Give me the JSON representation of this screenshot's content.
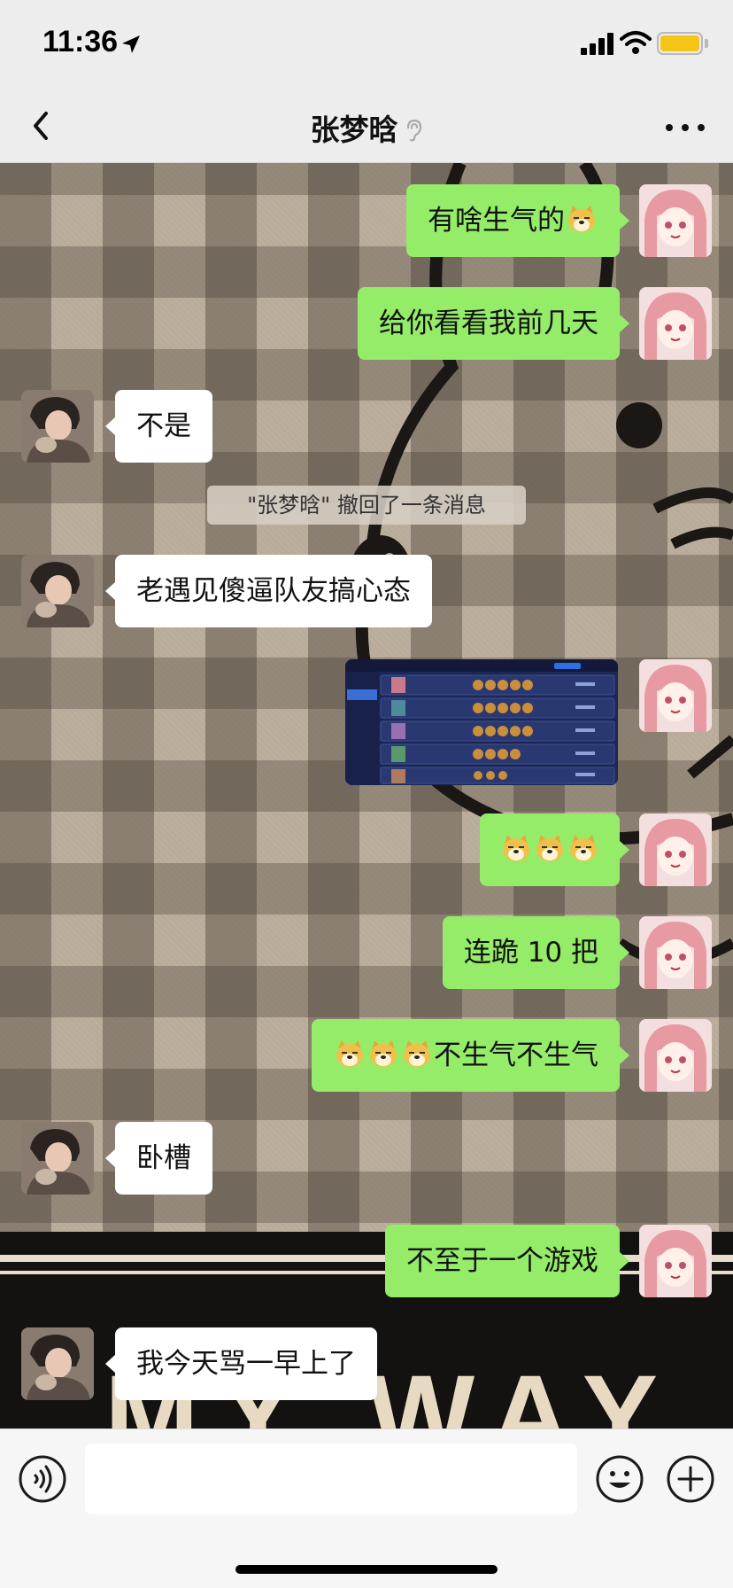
{
  "status_bar": {
    "time": "11:36",
    "signal_icon": "cellular-signal-icon",
    "wifi_icon": "wifi-icon",
    "battery_icon": "battery-icon",
    "battery_color": "#f5c518"
  },
  "nav": {
    "title": "张梦晗",
    "back_icon": "chevron-left-icon",
    "muted_icon": "ear-icon",
    "more_icon": "ellipsis-icon"
  },
  "colors": {
    "my_bubble": "#95ec69",
    "their_bubble": "#ffffff",
    "app_bg": "#ededed"
  },
  "messages": [
    {
      "sender": "me",
      "type": "text",
      "text": "有啥生气的",
      "emoji": [
        "doge"
      ]
    },
    {
      "sender": "me",
      "type": "text",
      "text": "给你看看我前几天"
    },
    {
      "sender": "other",
      "type": "text",
      "text": "不是"
    },
    {
      "sender": "system",
      "type": "notice",
      "text": "\"张梦晗\" 撤回了一条消息"
    },
    {
      "sender": "other",
      "type": "text",
      "text": "老遇见傻逼队友搞心态"
    },
    {
      "sender": "me",
      "type": "image",
      "description_icon": "game-record-screenshot"
    },
    {
      "sender": "me",
      "type": "emoji",
      "emoji": [
        "doge",
        "doge",
        "doge"
      ]
    },
    {
      "sender": "me",
      "type": "text",
      "text": "连跪 10 把"
    },
    {
      "sender": "me",
      "type": "text",
      "emoji": [
        "doge",
        "doge",
        "doge"
      ],
      "text": "不生气不生气"
    },
    {
      "sender": "other",
      "type": "text",
      "text": "卧槽"
    },
    {
      "sender": "me",
      "type": "text",
      "text": "不至于一个游戏"
    },
    {
      "sender": "other",
      "type": "text",
      "text": "我今天骂一早上了"
    }
  ],
  "wallpaper": {
    "text": "MY WAY"
  },
  "input_bar": {
    "value": "",
    "voice_icon": "voice-icon",
    "emoji_icon": "smiley-icon",
    "plus_icon": "plus-circle-icon"
  }
}
